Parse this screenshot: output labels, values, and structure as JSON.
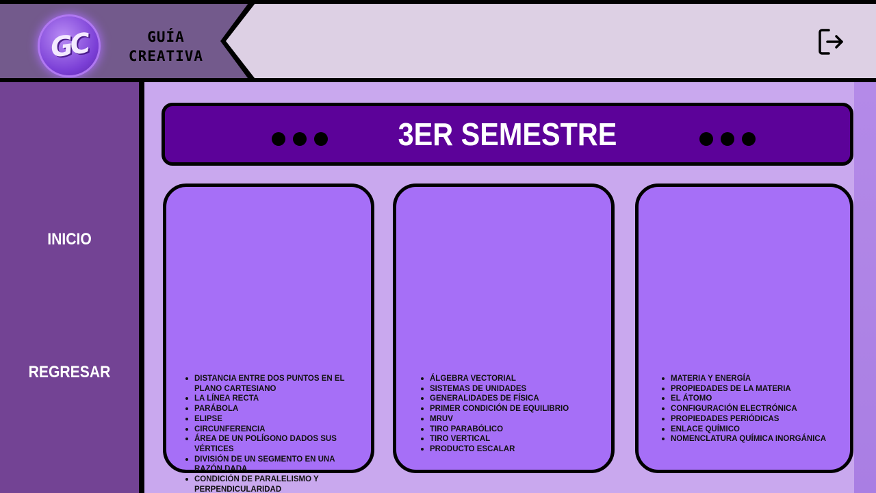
{
  "header": {
    "logo_text": "GC",
    "brand_line1": "GUÍA",
    "brand_line2": "CREATIVA",
    "exit_icon": "logout-icon"
  },
  "sidebar": {
    "items": [
      {
        "label": "INICIO"
      },
      {
        "label": "REGRESAR"
      }
    ]
  },
  "main": {
    "title": "3ER SEMESTRE",
    "cards": [
      {
        "topics": [
          "Distancia entre dos puntos en el plano cartesiano",
          "La línea recta",
          "Parábola",
          "Elipse",
          "Circunferencia",
          "Área de un polígono dados sus vértices",
          "División de un segmento en una razón dada",
          "Condición de paralelismo y perpendicularidad"
        ]
      },
      {
        "topics": [
          "Álgebra vectorial",
          "Sistemas de unidades",
          "Generalidades de física",
          "Primer condición de equilibrio",
          "MRUV",
          "Tiro parabólico",
          "Tiro vertical",
          "Producto escalar"
        ]
      },
      {
        "topics": [
          "Materia y energía",
          "Propiedades de la materia",
          "El átomo",
          "Configuración electrónica",
          "Propiedades periódicas",
          "Enlace químico",
          "Nomenclatura química inorgánica"
        ]
      }
    ]
  },
  "colors": {
    "sidebar": "#734394",
    "banner": "#5c0299",
    "card": "#a66ff7",
    "background": "#c9a8ee"
  }
}
